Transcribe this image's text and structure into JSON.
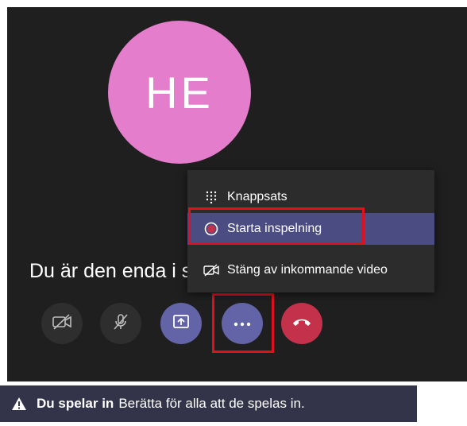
{
  "call": {
    "avatar_initials": "HE",
    "status_text": "Du är den enda i samtalet",
    "colors": {
      "background": "#1f1f1f",
      "avatar": "#e37dcc",
      "accent": "#6264a7",
      "hangup": "#c4314b"
    }
  },
  "controls": [
    {
      "id": "camera",
      "icon": "camera-off-icon"
    },
    {
      "id": "mic",
      "icon": "mic-off-icon"
    },
    {
      "id": "share",
      "icon": "share-screen-icon"
    },
    {
      "id": "more",
      "icon": "more-options-icon"
    },
    {
      "id": "hangup",
      "icon": "hang-up-icon"
    }
  ],
  "menu": {
    "items": [
      {
        "label": "Knappsats",
        "icon": "dialpad-icon"
      },
      {
        "label": "Starta inspelning",
        "icon": "record-icon",
        "selected": true
      },
      {
        "label": "Stäng av inkommande video",
        "icon": "video-off-icon"
      }
    ]
  },
  "banner": {
    "icon": "warning-icon",
    "title": "Du spelar in",
    "message": "Berätta för alla att de spelas in."
  }
}
